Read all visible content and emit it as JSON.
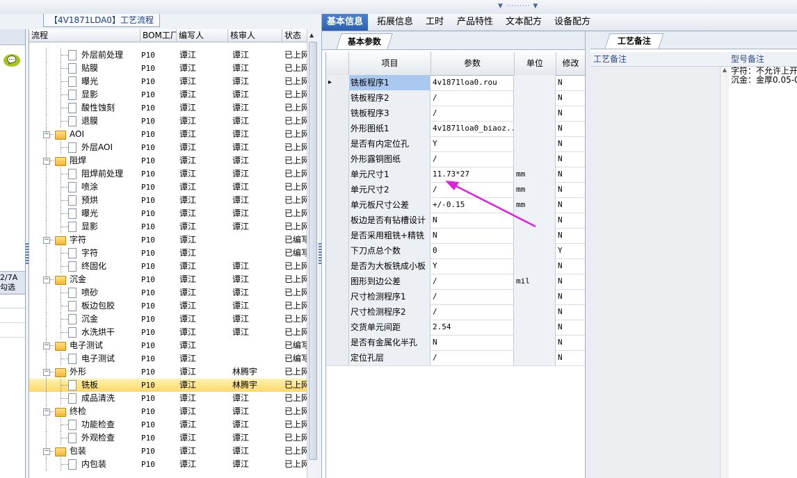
{
  "window": {
    "title": "【4V1871LDA0】工艺流程"
  },
  "far_left": {
    "tab_line1": "2/7A",
    "tab_line2": "勾选"
  },
  "tree": {
    "headers": [
      "流程",
      "BOM工厂",
      "编写人",
      "核审人",
      "状态"
    ],
    "rows": [
      {
        "level": 2,
        "type": "doc",
        "name": "外层前处理",
        "bom": "P10",
        "writer": "谭江",
        "reviewer": "谭江",
        "status": "已上网"
      },
      {
        "level": 2,
        "type": "doc",
        "name": "贴膜",
        "bom": "P10",
        "writer": "谭江",
        "reviewer": "谭江",
        "status": "已上网"
      },
      {
        "level": 2,
        "type": "doc",
        "name": "曝光",
        "bom": "P10",
        "writer": "谭江",
        "reviewer": "谭江",
        "status": "已上网"
      },
      {
        "level": 2,
        "type": "doc",
        "name": "显影",
        "bom": "P10",
        "writer": "谭江",
        "reviewer": "谭江",
        "status": "已上网"
      },
      {
        "level": 2,
        "type": "doc",
        "name": "酸性蚀刻",
        "bom": "P10",
        "writer": "谭江",
        "reviewer": "谭江",
        "status": "已上网"
      },
      {
        "level": 2,
        "type": "doc",
        "name": "退膜",
        "bom": "P10",
        "writer": "谭江",
        "reviewer": "谭江",
        "status": "已上网"
      },
      {
        "level": 1,
        "type": "folder",
        "name": "AOI",
        "bom": "P10",
        "writer": "谭江",
        "reviewer": "谭江",
        "status": "已上网"
      },
      {
        "level": 2,
        "type": "doc",
        "name": "外层AOI",
        "bom": "P10",
        "writer": "谭江",
        "reviewer": "谭江",
        "status": "已上网"
      },
      {
        "level": 1,
        "type": "folder",
        "name": "阻焊",
        "bom": "P10",
        "writer": "谭江",
        "reviewer": "谭江",
        "status": "已上网"
      },
      {
        "level": 2,
        "type": "doc",
        "name": "阻焊前处理",
        "bom": "P10",
        "writer": "谭江",
        "reviewer": "谭江",
        "status": "已上网"
      },
      {
        "level": 2,
        "type": "doc",
        "name": "喷涂",
        "bom": "P10",
        "writer": "谭江",
        "reviewer": "谭江",
        "status": "已上网"
      },
      {
        "level": 2,
        "type": "doc",
        "name": "预烘",
        "bom": "P10",
        "writer": "谭江",
        "reviewer": "谭江",
        "status": "已上网"
      },
      {
        "level": 2,
        "type": "doc",
        "name": "曝光",
        "bom": "P10",
        "writer": "谭江",
        "reviewer": "谭江",
        "status": "已上网"
      },
      {
        "level": 2,
        "type": "doc",
        "name": "显影",
        "bom": "P10",
        "writer": "谭江",
        "reviewer": "谭江",
        "status": "已上网"
      },
      {
        "level": 1,
        "type": "folder",
        "name": "字符",
        "bom": "P10",
        "writer": "谭江",
        "reviewer": "",
        "status": "已编写"
      },
      {
        "level": 2,
        "type": "doc",
        "name": "字符",
        "bom": "P10",
        "writer": "谭江",
        "reviewer": "",
        "status": "已编写"
      },
      {
        "level": 2,
        "type": "doc",
        "name": "终固化",
        "bom": "P10",
        "writer": "谭江",
        "reviewer": "谭江",
        "status": "已上网"
      },
      {
        "level": 1,
        "type": "folder",
        "name": "沉金",
        "bom": "P10",
        "writer": "谭江",
        "reviewer": "谭江",
        "status": "已上网"
      },
      {
        "level": 2,
        "type": "doc",
        "name": "喷砂",
        "bom": "P10",
        "writer": "谭江",
        "reviewer": "谭江",
        "status": "已上网"
      },
      {
        "level": 2,
        "type": "doc",
        "name": "板边包胶",
        "bom": "P10",
        "writer": "谭江",
        "reviewer": "谭江",
        "status": "已上网"
      },
      {
        "level": 2,
        "type": "doc",
        "name": "沉金",
        "bom": "P10",
        "writer": "谭江",
        "reviewer": "谭江",
        "status": "已上网"
      },
      {
        "level": 2,
        "type": "doc",
        "name": "水洗烘干",
        "bom": "P10",
        "writer": "谭江",
        "reviewer": "谭江",
        "status": "已上网"
      },
      {
        "level": 1,
        "type": "folder",
        "name": "电子测试",
        "bom": "P10",
        "writer": "谭江",
        "reviewer": "",
        "status": "已编写"
      },
      {
        "level": 2,
        "type": "doc",
        "name": "电子测试",
        "bom": "P10",
        "writer": "谭江",
        "reviewer": "",
        "status": "已编写"
      },
      {
        "level": 1,
        "type": "folder",
        "name": "外形",
        "bom": "P10",
        "writer": "谭江",
        "reviewer": "林腾宇",
        "status": "已上网"
      },
      {
        "level": 2,
        "type": "doc",
        "name": "铣板",
        "bom": "P10",
        "writer": "谭江",
        "reviewer": "林腾宇",
        "status": "已上网",
        "selected": true
      },
      {
        "level": 2,
        "type": "doc",
        "name": "成品清洗",
        "bom": "P10",
        "writer": "谭江",
        "reviewer": "谭江",
        "status": "已上网"
      },
      {
        "level": 1,
        "type": "folder",
        "name": "终检",
        "bom": "P10",
        "writer": "谭江",
        "reviewer": "谭江",
        "status": "已上网"
      },
      {
        "level": 2,
        "type": "doc",
        "name": "功能检查",
        "bom": "P10",
        "writer": "谭江",
        "reviewer": "谭江",
        "status": "已上网"
      },
      {
        "level": 2,
        "type": "doc",
        "name": "外观检查",
        "bom": "P10",
        "writer": "谭江",
        "reviewer": "谭江",
        "status": "已上网"
      },
      {
        "level": 1,
        "type": "folder",
        "name": "包装",
        "bom": "P10",
        "writer": "谭江",
        "reviewer": "谭江",
        "status": "已上网"
      },
      {
        "level": 2,
        "type": "doc",
        "name": "内包装",
        "bom": "P10",
        "writer": "谭江",
        "reviewer": "谭江",
        "status": "已上网"
      }
    ]
  },
  "main_tabs": [
    "基本信息",
    "拓展信息",
    "工时",
    "产品特性",
    "文本配方",
    "设备配方"
  ],
  "sub_tab": "基本参数",
  "params": {
    "headers": [
      "项目",
      "参数",
      "单位",
      "修改"
    ],
    "rows": [
      {
        "item": "铣板程序1",
        "value": "4v1871loa0.rou",
        "unit": "",
        "mod": "N",
        "selected": true
      },
      {
        "item": "铣板程序2",
        "value": "/",
        "unit": "",
        "mod": "N"
      },
      {
        "item": "铣板程序3",
        "value": "/",
        "unit": "",
        "mod": "N"
      },
      {
        "item": "外形图纸1",
        "value": "4v1871loa0_biaoz...",
        "unit": "",
        "mod": "N"
      },
      {
        "item": "是否有内定位孔",
        "value": "Y",
        "unit": "",
        "mod": "N"
      },
      {
        "item": "外形露铜图纸",
        "value": "/",
        "unit": "",
        "mod": "N"
      },
      {
        "item": "单元尺寸1",
        "value": "11.73*27",
        "unit": "mm",
        "mod": "N"
      },
      {
        "item": "单元尺寸2",
        "value": "/",
        "unit": "mm",
        "mod": "N"
      },
      {
        "item": "单元板尺寸公差",
        "value": "+/-0.15",
        "unit": "mm",
        "mod": "N"
      },
      {
        "item": "板边是否有钻槽设计",
        "value": "N",
        "unit": "",
        "mod": "N"
      },
      {
        "item": "是否采用粗铣+精铣",
        "value": "N",
        "unit": "",
        "mod": "N"
      },
      {
        "item": "下刀点总个数",
        "value": "0",
        "unit": "",
        "mod": "Y"
      },
      {
        "item": "是否为大板铣成小板",
        "value": "Y",
        "unit": "",
        "mod": "N"
      },
      {
        "item": "图形到边公差",
        "value": "/",
        "unit": "mil",
        "mod": "N"
      },
      {
        "item": "尺寸检测程序1",
        "value": "/",
        "unit": "",
        "mod": "N"
      },
      {
        "item": "尺寸检测程序2",
        "value": "/",
        "unit": "",
        "mod": "N"
      },
      {
        "item": "交货单元间距",
        "value": "2.54",
        "unit": "",
        "mod": "N"
      },
      {
        "item": "是否有金属化半孔",
        "value": "N",
        "unit": "",
        "mod": "N"
      },
      {
        "item": "定位孔层",
        "value": "/",
        "unit": "",
        "mod": "N"
      }
    ]
  },
  "notes": {
    "tab": "工艺备注",
    "process_label": "工艺备注",
    "model_label": "型号备注",
    "model_text_line1": "字符：不允许上开",
    "model_text_line2": "沉金：金厚0.05-0"
  },
  "colors": {
    "tab_active": "#2c5fb0",
    "selected_row": "#ffd86b",
    "annotation_arrow": "#e020e0"
  }
}
